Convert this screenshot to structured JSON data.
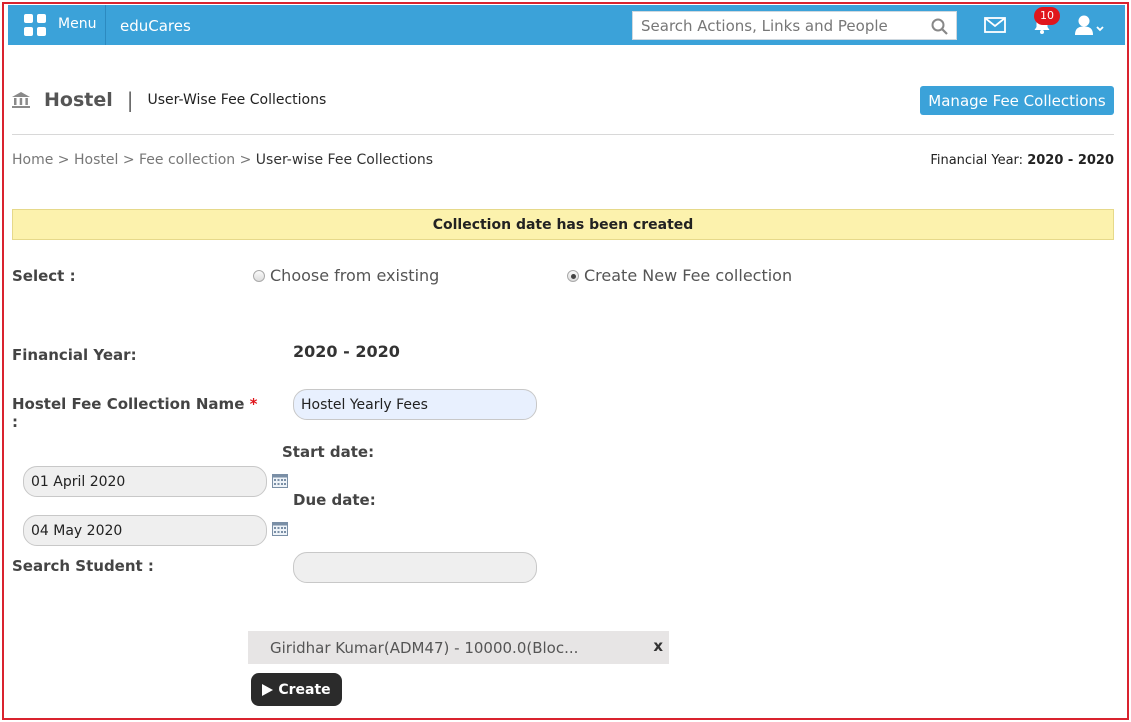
{
  "topbar": {
    "menu_label": "Menu",
    "brand": "eduCares",
    "search_placeholder": "Search Actions, Links and People",
    "notification_count": "10"
  },
  "header": {
    "title": "Hostel",
    "separator": "|",
    "subtitle": "User-Wise Fee Collections",
    "manage_button": "Manage Fee Collections"
  },
  "breadcrumb": {
    "items": [
      "Home",
      "Hostel",
      "Fee collection",
      "User-wise Fee Collections"
    ],
    "separator": ">"
  },
  "financial_year_top": {
    "label": "Financial Year:",
    "value": "2020 - 2020"
  },
  "notice": "Collection date has been created",
  "form": {
    "select_label": "Select :",
    "option_existing": "Choose from existing",
    "option_new": "Create New Fee collection",
    "selected_option": "new",
    "financial_year_label": "Financial Year:",
    "financial_year_value": "2020 - 2020",
    "collection_name_label": "Hostel Fee Collection Name",
    "required_mark": "*",
    "colon": ":",
    "collection_name_value": "Hostel Yearly Fees",
    "start_date_label": "Start date:",
    "start_date_value": "01 April 2020",
    "due_date_label": "Due date:",
    "due_date_value": "04 May 2020",
    "search_student_label": "Search Student :",
    "search_student_value": ""
  },
  "selected_student": {
    "text": "Giridhar Kumar(ADM47) - 10000.0(Bloc...",
    "close": "x"
  },
  "create_button": "Create",
  "colors": {
    "accent": "#3ba2d9",
    "notice_bg": "#fcf2ad",
    "frame_border": "#d9232e",
    "badge": "#e0161c"
  }
}
